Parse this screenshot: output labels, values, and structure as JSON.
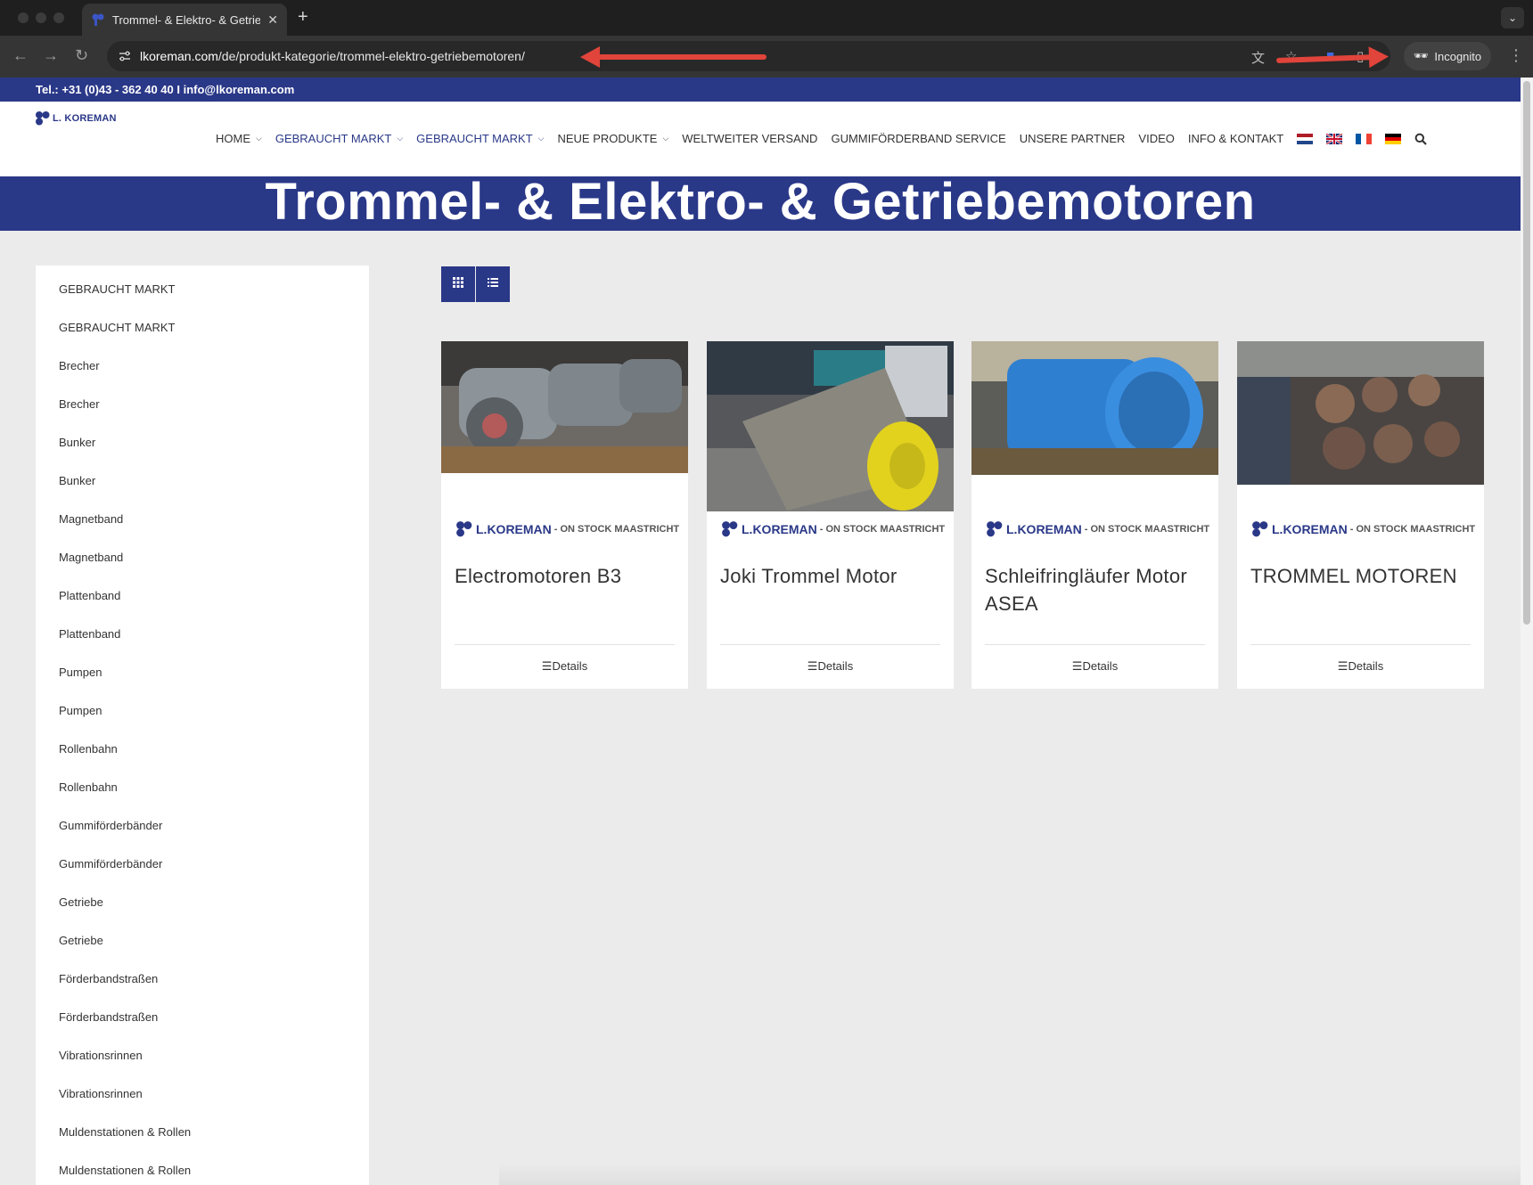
{
  "browser": {
    "tab_title": "Trommel- & Elektro- & Getrie",
    "url_domain": "lkoreman.com",
    "url_path": "/de/produkt-kategorie/trommel-elektro-getriebemotoren/",
    "incognito_label": "Incognito"
  },
  "topbar": {
    "contact": "Tel.: +31 (0)43 - 362 40 40  I  info@lkoreman.com"
  },
  "logo": {
    "text": "L. KOREMAN"
  },
  "nav": {
    "items": [
      {
        "label": "HOME",
        "has_dropdown": true
      },
      {
        "label": "GEBRAUCHT MARKT",
        "has_dropdown": true
      },
      {
        "label": "GEBRAUCHT MARKT",
        "has_dropdown": true
      },
      {
        "label": "NEUE PRODUKTE",
        "has_dropdown": true
      },
      {
        "label": "WELTWEITER VERSAND",
        "has_dropdown": false
      },
      {
        "label": "GUMMIFÖRDERBAND SERVICE",
        "has_dropdown": false
      },
      {
        "label": "UNSERE PARTNER",
        "has_dropdown": false
      },
      {
        "label": "VIDEO",
        "has_dropdown": false
      },
      {
        "label": "INFO & KONTAKT",
        "has_dropdown": false
      }
    ],
    "flags": [
      "flag-nl-icon",
      "flag-uk-icon",
      "flag-fr-icon",
      "flag-de-icon"
    ],
    "accent_color": "#2a3888"
  },
  "banner": {
    "title": "Trommel- & Elektro- & Getriebemotoren"
  },
  "sidebar": {
    "items": [
      "GEBRAUCHT MARKT",
      "GEBRAUCHT MARKT",
      "Brecher",
      "Brecher",
      "Bunker",
      "Bunker",
      "Magnetband",
      "Magnetband",
      "Plattenband",
      "Plattenband",
      "Pumpen",
      "Pumpen",
      "Rollenbahn",
      "Rollenbahn",
      "Gummiförderbänder",
      "Gummiförderbänder",
      "Getriebe",
      "Getriebe",
      "Förderbandstraßen",
      "Förderbandstraßen",
      "Vibrationsrinnen",
      "Vibrationsrinnen",
      "Muldenstationen & Rollen",
      "Muldenstationen & Rollen"
    ]
  },
  "view_toggle": {
    "grid_icon": "grid-icon",
    "list_icon": "list-icon"
  },
  "products": [
    {
      "brand_name": "L.KOREMAN",
      "brand_sub": "- ON STOCK MAASTRICHT",
      "title": "Electromotoren B3",
      "details": "Details"
    },
    {
      "brand_name": "L.KOREMAN",
      "brand_sub": "- ON STOCK MAASTRICHT",
      "title": "Joki Trommel Motor",
      "details": "Details"
    },
    {
      "brand_name": "L.KOREMAN",
      "brand_sub": "- ON STOCK MAASTRICHT",
      "title": "Schleifringläufer Motor ASEA",
      "details": "Details"
    },
    {
      "brand_name": "L.KOREMAN",
      "brand_sub": "- ON STOCK MAASTRICHT",
      "title": "TROMMEL MOTOREN",
      "details": "Details"
    }
  ]
}
